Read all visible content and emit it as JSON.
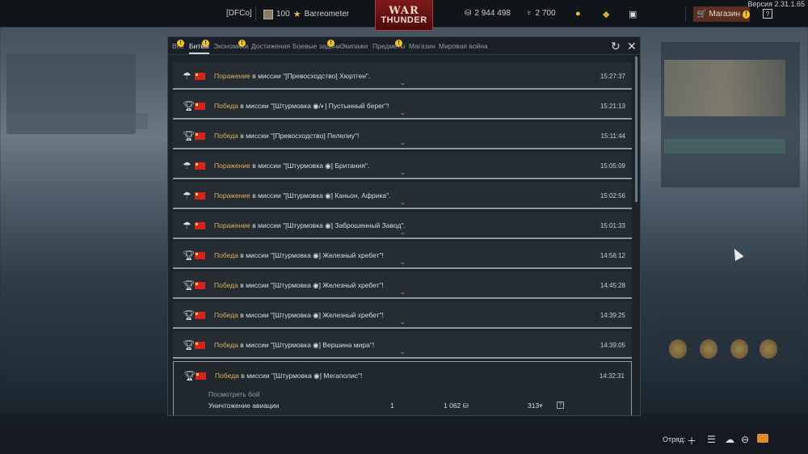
{
  "version": "Версия 2.31.1.65",
  "topbar": {
    "squadron": "[DFCo]",
    "level": "100",
    "username": "Barreometer",
    "logo_line1": "WAR",
    "logo_line2": "THUNDER",
    "silver_lions": "2 944 498",
    "golden_eagles": "2 700",
    "shop_label": "Магазин"
  },
  "tabs": [
    {
      "label": "Все",
      "badge": true,
      "active": false
    },
    {
      "label": "Битвы",
      "badge": true,
      "active": true
    },
    {
      "label": "Экономика",
      "badge": true,
      "active": false
    },
    {
      "label": "Достижения",
      "badge": false,
      "active": false
    },
    {
      "label": "Боевые задачи",
      "badge": true,
      "active": false
    },
    {
      "label": "Экипажи",
      "badge": false,
      "active": false
    },
    {
      "label": "Предметы",
      "badge": true,
      "active": false
    },
    {
      "label": "Магазин",
      "badge": false,
      "active": false
    },
    {
      "label": "Мировая война",
      "badge": false,
      "active": false
    }
  ],
  "battles": [
    {
      "result": "Поражение",
      "pre": " в миссии \"[Превосходство] Хюртген\".",
      "icon": "parachute-icon",
      "time": "15:27:37"
    },
    {
      "result": "Победа",
      "pre": " в миссии \"[Штурмовка ◉/◐] Пустынный берег\"!",
      "icon": "trophy-icon",
      "time": "15:21:13"
    },
    {
      "result": "Победа",
      "pre": " в миссии \"[Превосходство] Пелелиу\"!",
      "icon": "trophy-icon",
      "time": "15:11:44"
    },
    {
      "result": "Поражение",
      "pre": " в миссии \"[Штурмовка ◉] Британия\".",
      "icon": "parachute-icon",
      "time": "15:05:09"
    },
    {
      "result": "Поражение",
      "pre": " в миссии \"[Штурмовка ◉] Каньон, Африка\".",
      "icon": "parachute-icon",
      "time": "15:02:56"
    },
    {
      "result": "Поражение",
      "pre": " в миссии \"[Штурмовка ◉] Заброшенный Завод\".",
      "icon": "parachute-icon",
      "time": "15:01:33"
    },
    {
      "result": "Победа",
      "pre": " в миссии \"[Штурмовка ◉] Железный хребет\"!",
      "icon": "trophy-icon",
      "time": "14:56:12"
    },
    {
      "result": "Победа",
      "pre": " в миссии \"[Штурмовка ◉] Железный хребет\"!",
      "icon": "trophy-icon",
      "time": "14:45:28"
    },
    {
      "result": "Победа",
      "pre": " в миссии \"[Штурмовка ◉] Железный хребет\"!",
      "icon": "trophy-icon",
      "time": "14:39:25"
    },
    {
      "result": "Победа",
      "pre": " в миссии \"[Штурмовка ◉] Вершина мира\"!",
      "icon": "trophy-icon",
      "time": "14:39:05"
    },
    {
      "result": "Победа",
      "pre": " в миссии \"[Штурмовка ◉] Мегаполис\"!",
      "icon": "trophy-icon",
      "time": "14:32:31"
    }
  ],
  "expanded": {
    "view_battle": "Посмотреть бой",
    "stat_label": "Уничтожение авиации",
    "stat_count": "1",
    "stat_silver": "1 062",
    "stat_rp": "313"
  },
  "bottombar": {
    "squad_label": "Отряд:"
  }
}
